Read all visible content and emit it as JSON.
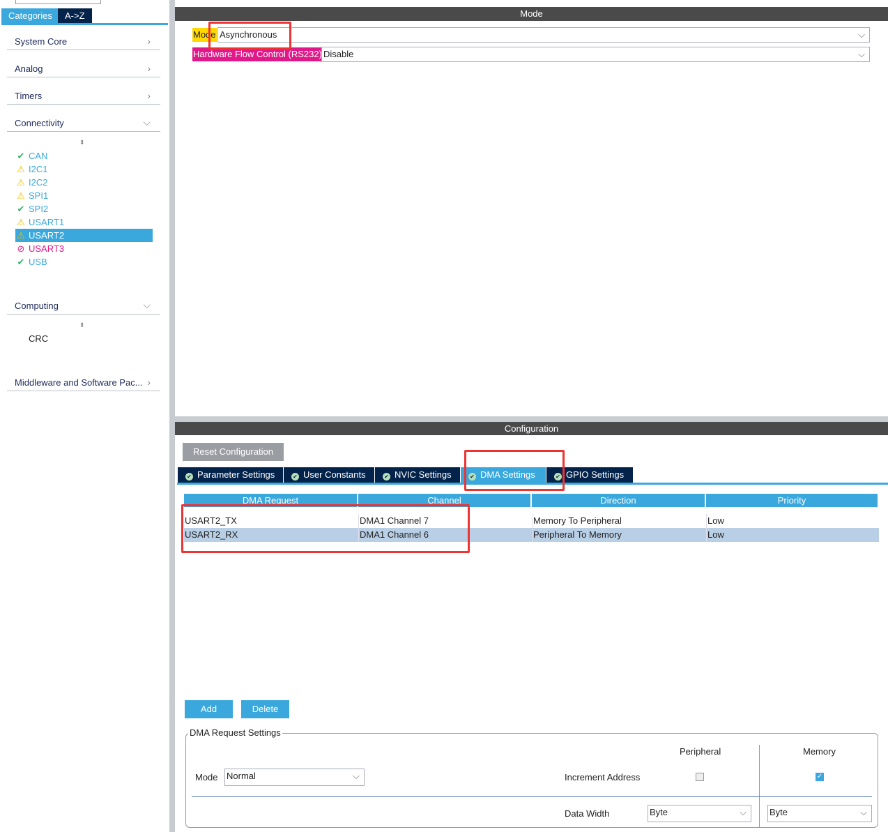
{
  "sidebar": {
    "tabs": [
      "Categories",
      "A->Z"
    ],
    "categories": [
      {
        "label": "System Core",
        "chevron": "right"
      },
      {
        "label": "Analog",
        "chevron": "right"
      },
      {
        "label": "Timers",
        "chevron": "right"
      },
      {
        "label": "Connectivity",
        "chevron": "down"
      },
      {
        "label": "Computing",
        "chevron": "down"
      },
      {
        "label": "Middleware and Software Pac...",
        "chevron": "right"
      }
    ],
    "connectivity": [
      {
        "label": "CAN",
        "status": "ok"
      },
      {
        "label": "I2C1",
        "status": "warn"
      },
      {
        "label": "I2C2",
        "status": "warn"
      },
      {
        "label": "SPI1",
        "status": "warn"
      },
      {
        "label": "SPI2",
        "status": "ok"
      },
      {
        "label": "USART1",
        "status": "warn"
      },
      {
        "label": "USART2",
        "status": "warn",
        "selected": true
      },
      {
        "label": "USART3",
        "status": "disabled"
      },
      {
        "label": "USB",
        "status": "ok"
      }
    ],
    "computing": [
      {
        "label": "CRC"
      }
    ]
  },
  "mode": {
    "header": "Mode",
    "mode_label": "Mode",
    "mode_value": "Asynchronous",
    "flow_label": "Hardware Flow Control (RS232)",
    "flow_value": "Disable"
  },
  "config": {
    "header": "Configuration",
    "reset": "Reset Configuration",
    "tabs": [
      "Parameter Settings",
      "User Constants",
      "NVIC Settings",
      "DMA Settings",
      "GPIO Settings"
    ],
    "active_tab": "DMA Settings",
    "columns": [
      "DMA Request",
      "Channel",
      "Direction",
      "Priority"
    ],
    "rows": [
      [
        "USART2_TX",
        "DMA1 Channel 7",
        "Memory To Peripheral",
        "Low"
      ],
      [
        "USART2_RX",
        "DMA1 Channel 6",
        "Peripheral To Memory",
        "Low"
      ]
    ],
    "add": "Add",
    "delete": "Delete",
    "settings": {
      "title": "DMA Request Settings",
      "mode_label": "Mode",
      "mode_value": "Normal",
      "peripheral": "Peripheral",
      "memory": "Memory",
      "increment": "Increment Address",
      "peripheral_inc": false,
      "memory_inc": true,
      "data_width": "Data Width",
      "peripheral_width": "Byte",
      "memory_width": "Byte"
    }
  },
  "colors": {
    "accent": "#3aa8dc",
    "dark": "#03234b",
    "highlight": "#ee3333",
    "row_selected": "#b8cfe6"
  }
}
